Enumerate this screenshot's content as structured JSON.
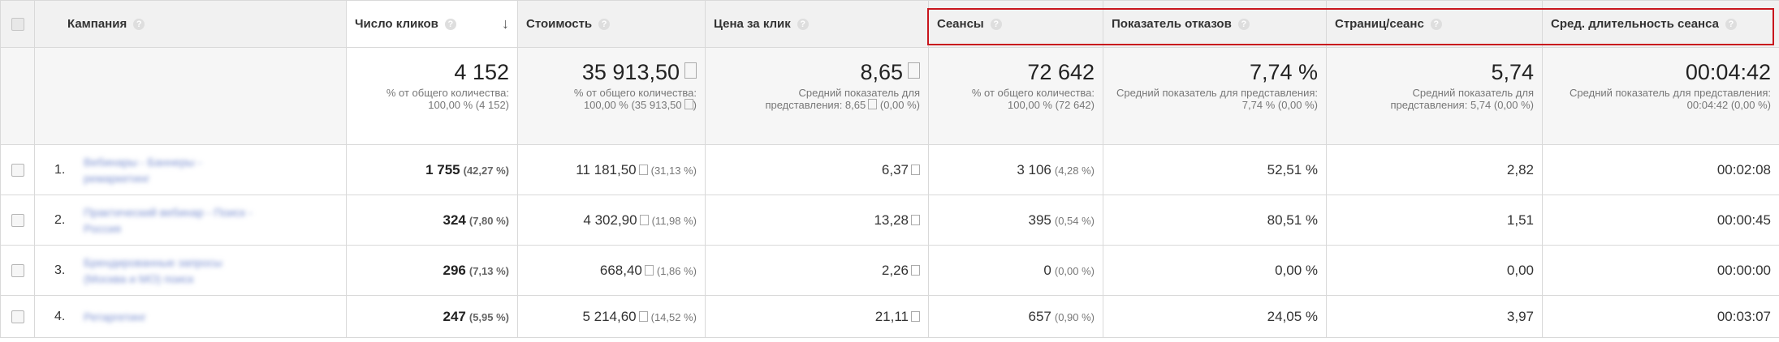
{
  "columns": {
    "campaign": "Кампания",
    "clicks": "Число кликов",
    "cost": "Стоимость",
    "cpc": "Цена за клик",
    "sessions": "Сеансы",
    "bounce_rate": "Показатель отказов",
    "pages_per_session": "Страниц/сеанс",
    "avg_session_duration": "Сред. длительность сеанса"
  },
  "help_glyph": "?",
  "sort_glyph": "↓",
  "summary": {
    "clicks": {
      "value": "4 152",
      "sub": "% от общего количества: 100,00 % (4 152)"
    },
    "cost": {
      "value": "35 913,50",
      "sub_a": "% от общего количества:",
      "sub_b": "100,00 % (35 913,50",
      "sub_c": ")"
    },
    "cpc": {
      "value": "8,65",
      "sub_a": "Средний показатель для",
      "sub_b": "представления: 8,65",
      "sub_c": "(0,00 %)"
    },
    "sessions": {
      "value": "72 642",
      "sub": "% от общего количества: 100,00 % (72 642)"
    },
    "bounce_rate": {
      "value": "7,74 %",
      "sub": "Средний показатель для представления: 7,74 % (0,00 %)"
    },
    "pages_per_session": {
      "value": "5,74",
      "sub": "Средний показатель для представления: 5,74 (0,00 %)"
    },
    "avg_session_duration": {
      "value": "00:04:42",
      "sub": "Средний показатель для представления: 00:04:42 (0,00 %)"
    }
  },
  "rows": [
    {
      "rank": "1.",
      "campaign": "Вебинары - Баннеры - ремаркетинг",
      "clicks": "1 755",
      "clicks_pct": "(42,27 %)",
      "cost": "11 181,50",
      "cost_pct": "(31,13 %)",
      "cpc": "6,37",
      "sessions": "3 106",
      "sessions_pct": "(4,28 %)",
      "bounce_rate": "52,51 %",
      "pages_per_session": "2,82",
      "avg_session_duration": "00:02:08"
    },
    {
      "rank": "2.",
      "campaign": "Практический вебинар - Поиск - Россия",
      "clicks": "324",
      "clicks_pct": "(7,80 %)",
      "cost": "4 302,90",
      "cost_pct": "(11,98 %)",
      "cpc": "13,28",
      "sessions": "395",
      "sessions_pct": "(0,54 %)",
      "bounce_rate": "80,51 %",
      "pages_per_session": "1,51",
      "avg_session_duration": "00:00:45"
    },
    {
      "rank": "3.",
      "campaign": "Брендированные запросы (Москва и МО) поиск",
      "clicks": "296",
      "clicks_pct": "(7,13 %)",
      "cost": "668,40",
      "cost_pct": "(1,86 %)",
      "cpc": "2,26",
      "sessions": "0",
      "sessions_pct": "(0,00 %)",
      "bounce_rate": "0,00 %",
      "pages_per_session": "0,00",
      "avg_session_duration": "00:00:00"
    },
    {
      "rank": "4.",
      "campaign": "Ретаргетинг",
      "clicks": "247",
      "clicks_pct": "(5,95 %)",
      "cost": "5 214,60",
      "cost_pct": "(14,52 %)",
      "cpc": "21,11",
      "sessions": "657",
      "sessions_pct": "(0,90 %)",
      "bounce_rate": "24,05 %",
      "pages_per_session": "3,97",
      "avg_session_duration": "00:03:07"
    }
  ]
}
